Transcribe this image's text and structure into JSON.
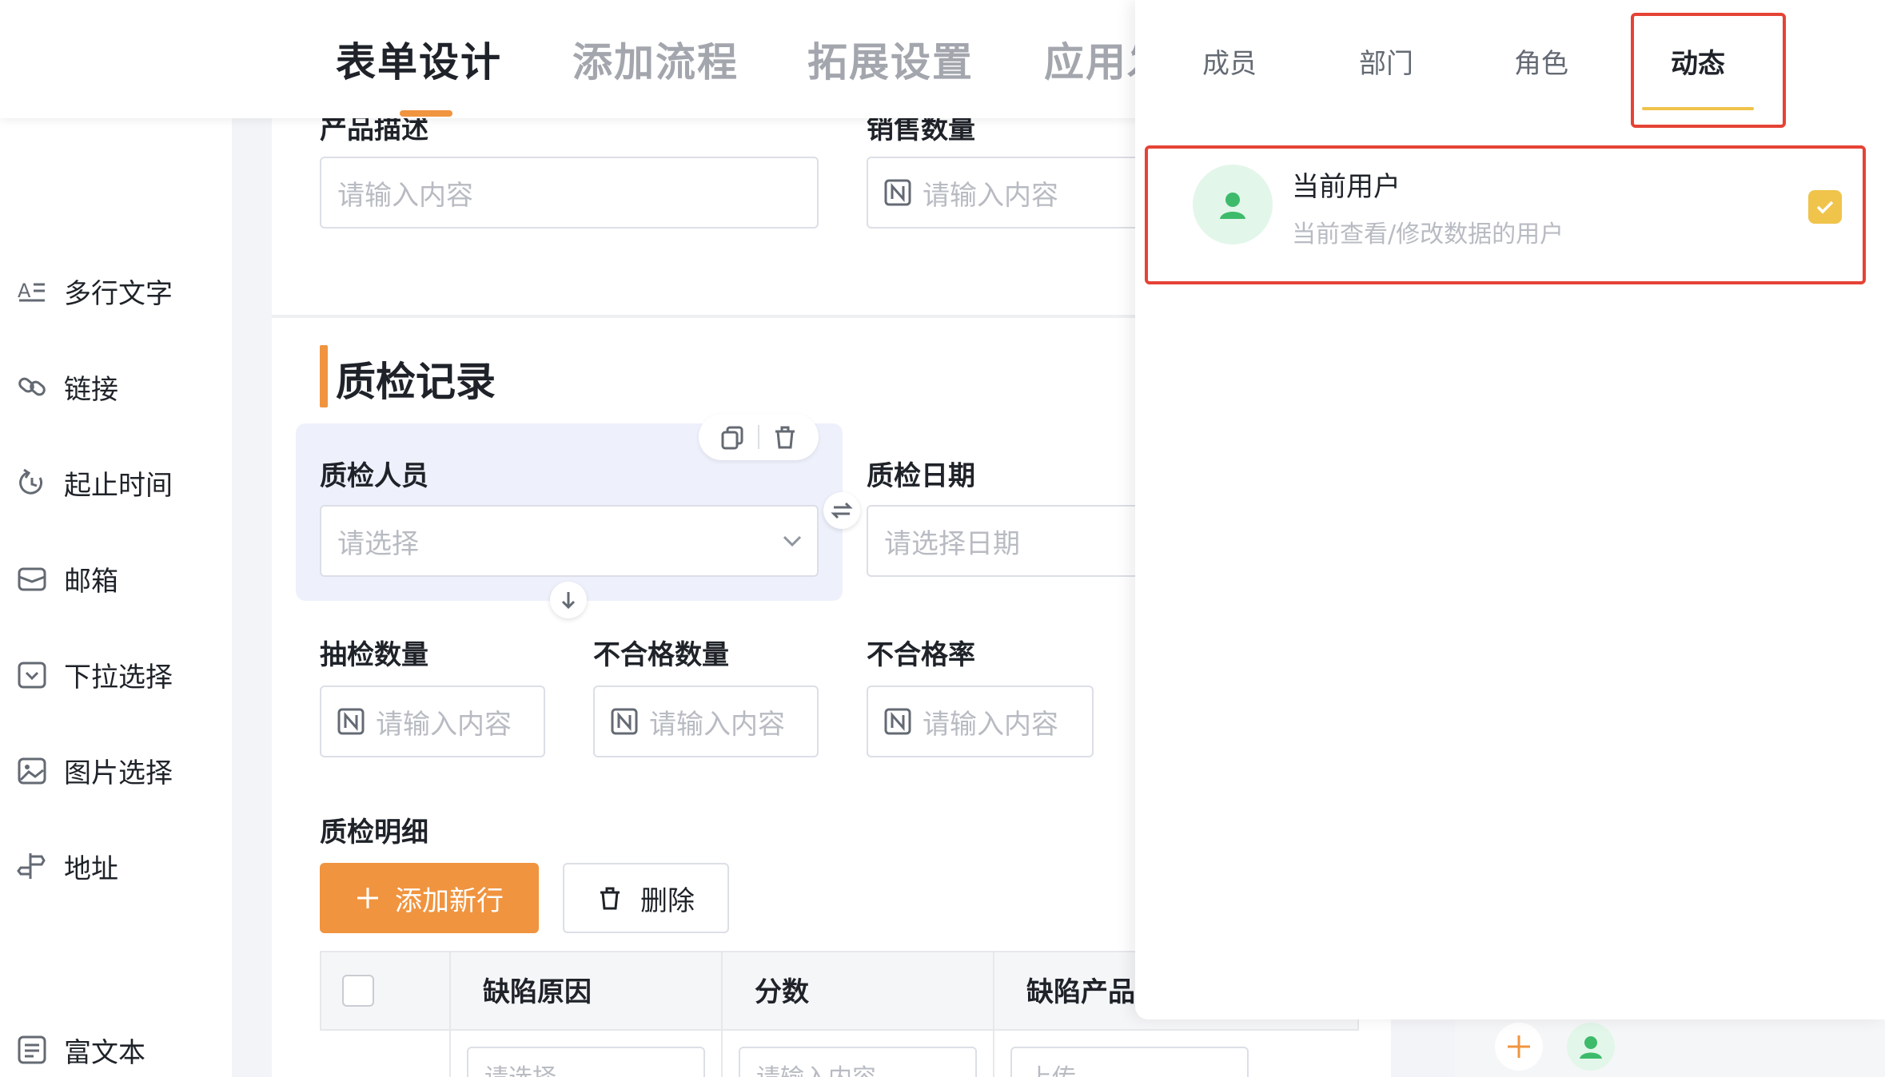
{
  "header": {
    "tabs": [
      {
        "label": "表单设计",
        "active": true
      },
      {
        "label": "添加流程",
        "active": false
      },
      {
        "label": "拓展设置",
        "active": false
      },
      {
        "label": "应用发",
        "active": false
      }
    ]
  },
  "sidebar": {
    "items": [
      {
        "label": "多行文字",
        "icon": "multiline-text-icon"
      },
      {
        "label": "链接",
        "icon": "link-icon"
      },
      {
        "label": "起止时间",
        "icon": "time-range-icon"
      },
      {
        "label": "邮箱",
        "icon": "mail-icon"
      },
      {
        "label": "下拉选择",
        "icon": "dropdown-icon"
      },
      {
        "label": "图片选择",
        "icon": "image-icon"
      },
      {
        "label": "地址",
        "icon": "location-icon"
      },
      {
        "label": "富文本",
        "icon": "rich-text-icon"
      }
    ]
  },
  "form": {
    "top_fields": [
      {
        "label": "产品描述",
        "placeholder": "请输入内容"
      },
      {
        "label": "销售数量",
        "placeholder": "请输入内容"
      }
    ],
    "section_title": "质检记录",
    "inspector": {
      "label": "质检人员",
      "placeholder": "请选择"
    },
    "date": {
      "label": "质检日期",
      "placeholder": "请选择日期"
    },
    "sample_qty": {
      "label": "抽检数量",
      "placeholder": "请输入内容"
    },
    "fail_qty": {
      "label": "不合格数量",
      "placeholder": "请输入内容"
    },
    "fail_rate": {
      "label": "不合格率",
      "placeholder": "请输入内容"
    },
    "detail_label": "质检明细",
    "add_row_label": "添加新行",
    "delete_label": "删除",
    "table": {
      "columns": [
        "缺陷原因",
        "分数",
        "缺陷产品"
      ],
      "row_placeholders": [
        "请选择",
        "请输入内容",
        "上传"
      ]
    }
  },
  "panel": {
    "tabs": [
      {
        "label": "成员",
        "active": false
      },
      {
        "label": "部门",
        "active": false
      },
      {
        "label": "角色",
        "active": false
      },
      {
        "label": "动态",
        "active": true
      }
    ],
    "option": {
      "title": "当前用户",
      "subtitle": "当前查看/修改数据的用户",
      "checked": true
    }
  },
  "colors": {
    "accent_orange": "#f0943f",
    "check_yellow": "#f0c34b",
    "highlight_red": "#e54335",
    "avatar_green": "#3dbb6b"
  }
}
